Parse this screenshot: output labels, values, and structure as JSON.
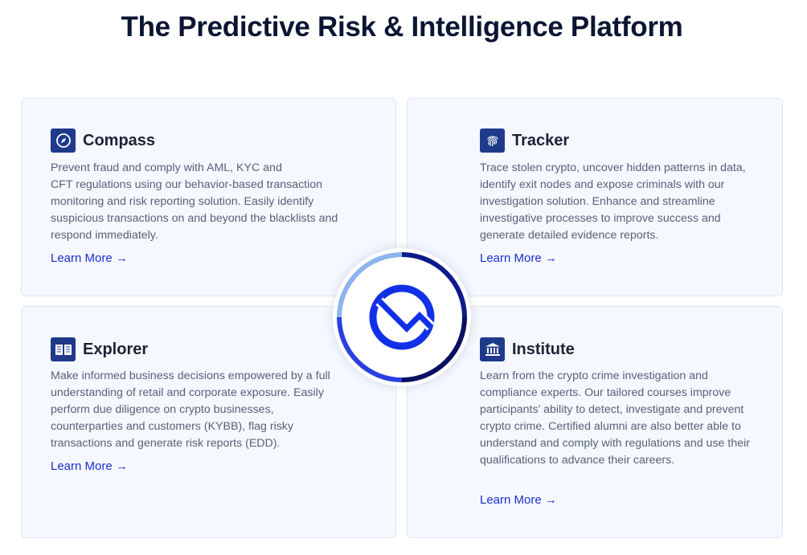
{
  "header": {
    "title": "The Predictive Risk & Intelligence Platform"
  },
  "cards": [
    {
      "title": "Compass",
      "icon": "compass-icon",
      "description": "Prevent fraud and comply with AML, KYC and\nCFT regulations using our behavior-based transaction monitoring and risk reporting solution. Easily identify suspicious transactions on and beyond the blacklists and respond immediately.",
      "link": "Learn More →"
    },
    {
      "title": "Tracker",
      "icon": "fingerprint-icon",
      "description": "Trace stolen crypto, uncover hidden patterns in data, identify exit nodes and expose criminals with our investigation solution. Enhance and streamline investigative processes to improve success and generate detailed evidence reports.",
      "link": "Learn More →"
    },
    {
      "title": "Explorer",
      "icon": "book-icon",
      "description": "Make informed business decisions empowered by a full understanding of retail and corporate exposure. Easily perform due diligence on crypto businesses, counterparties and customers (KYBB), flag risky transactions and generate risk reports (EDD).",
      "link": "Learn More →"
    },
    {
      "title": "Institute",
      "icon": "institution-icon",
      "description": "Learn from the crypto crime investigation and compliance experts. Our tailored courses improve participants’ ability to detect, investigate and prevent crypto crime. Certified alumni are also better able to understand and comply with regulations and use their qualifications to advance their careers.",
      "link": "Learn More →"
    }
  ],
  "hub": {
    "icon": "brand-logo-icon"
  },
  "colors": {
    "title": "#0b1533",
    "card_bg": "#f5f8fe",
    "icon_bg": "#1f3a8a",
    "link": "#1a2fd0",
    "text": "#566179",
    "logo_blue": "#1230e8",
    "ring_light": "#8db4ee",
    "ring_dark": "#0a1060"
  }
}
